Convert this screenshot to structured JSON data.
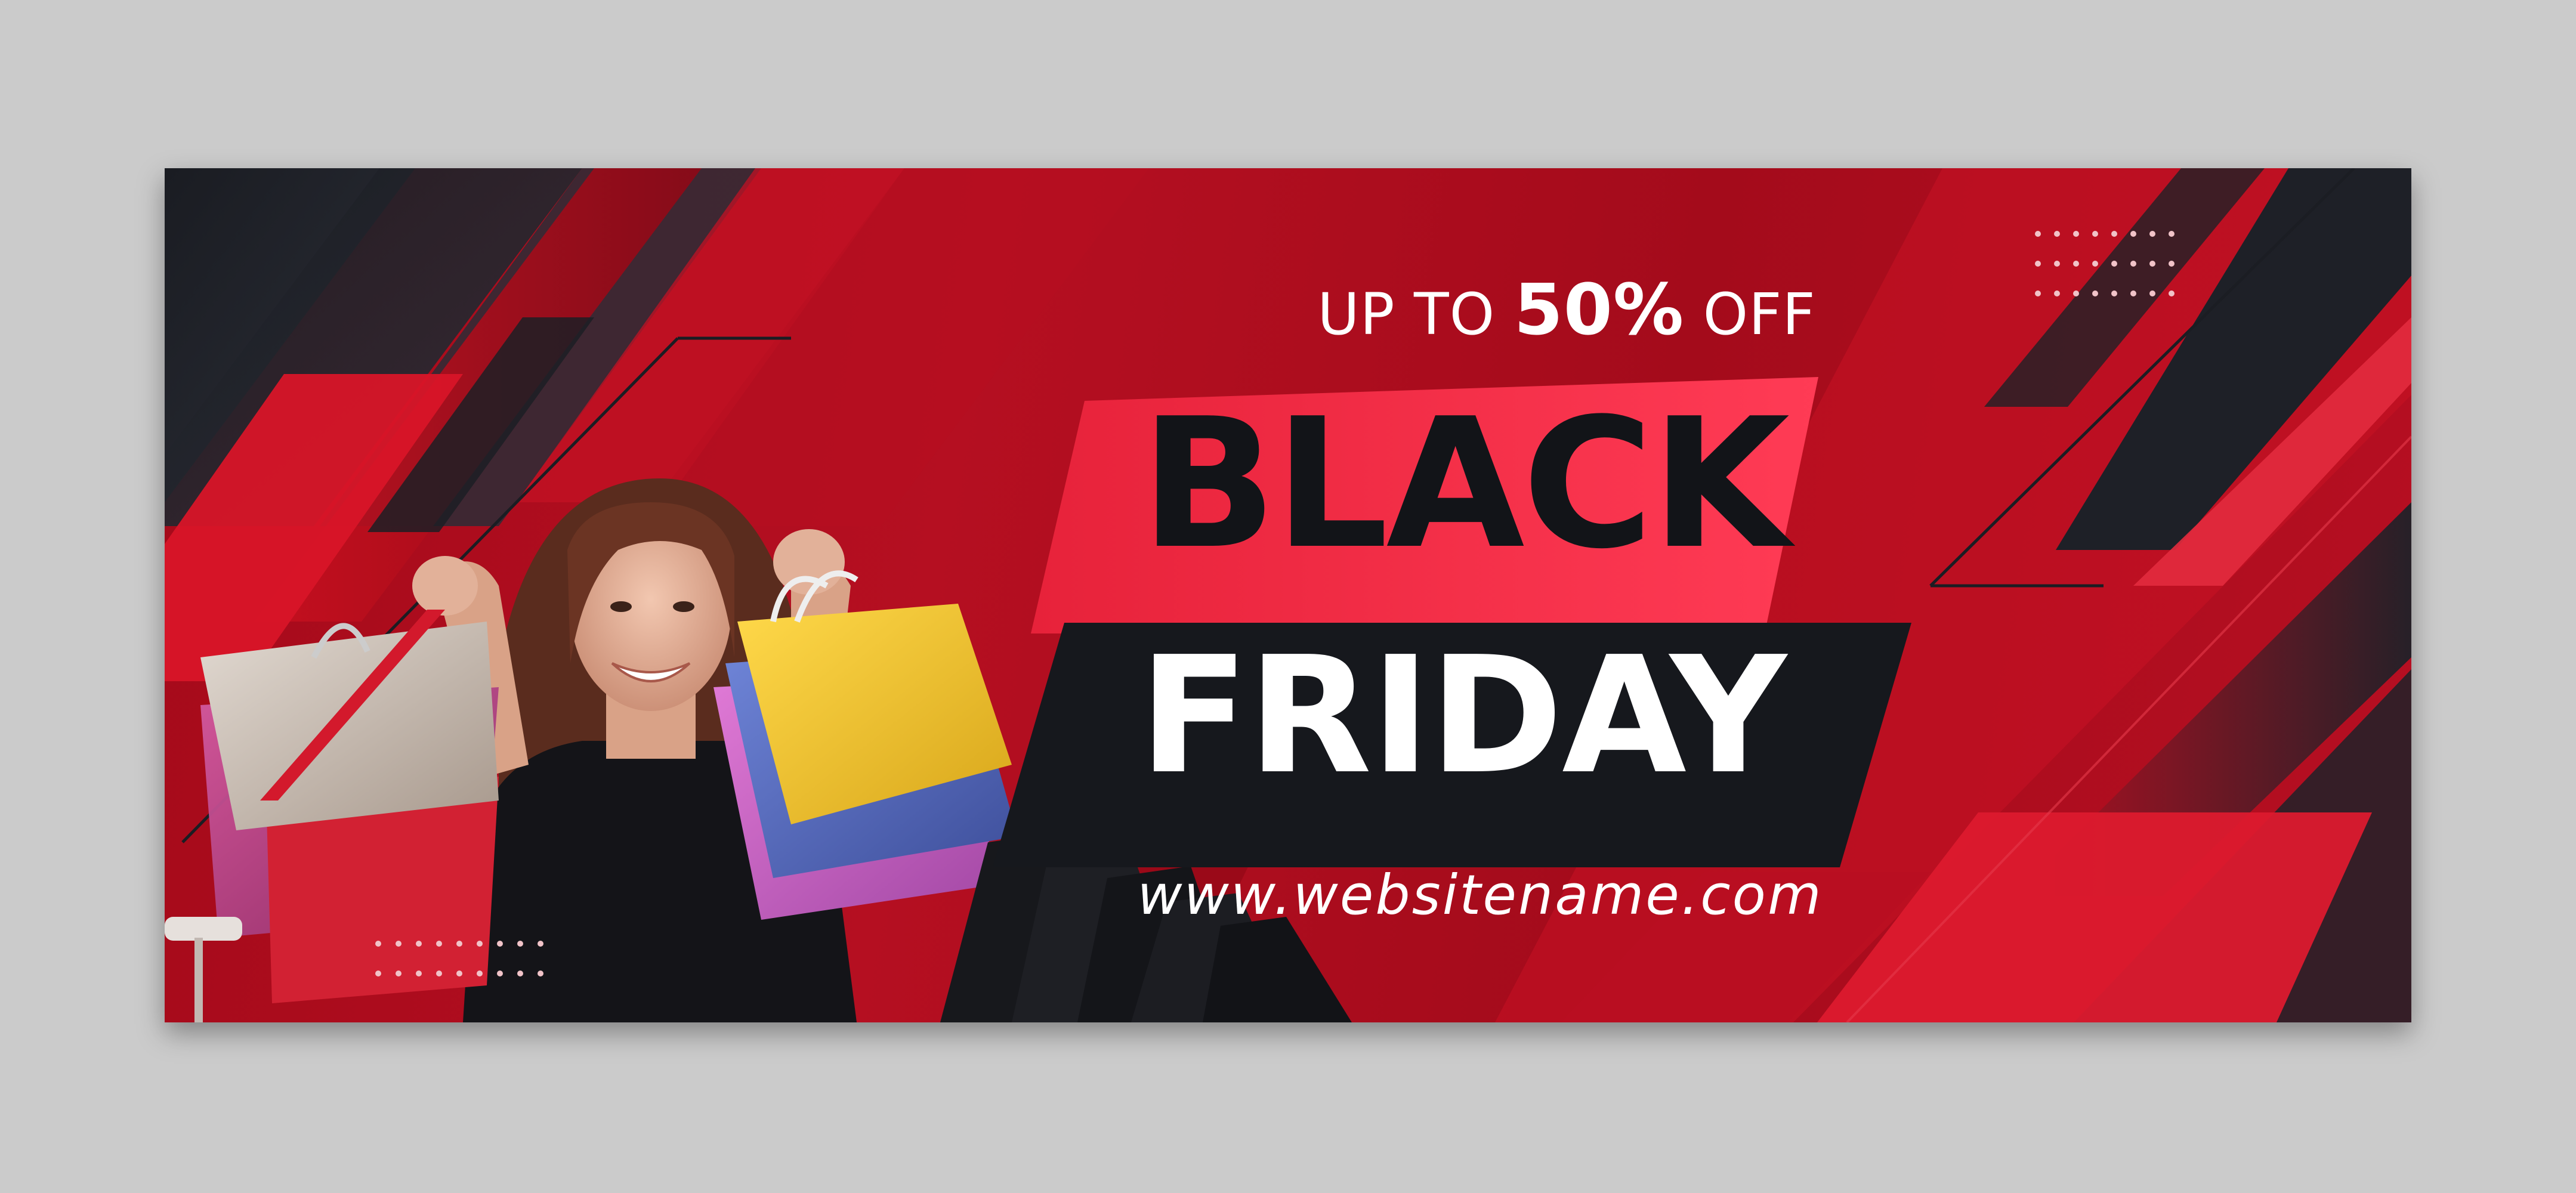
{
  "banner": {
    "offer_prefix": "UP TO",
    "offer_percent": "50%",
    "offer_suffix": "OFF",
    "title_line1": "BLACK",
    "title_line2": "FRIDAY",
    "website": "www.websitename.com"
  },
  "colors": {
    "page_bg": "#cbcbcb",
    "banner_red": "#b00e1f",
    "accent_red": "#e3253c",
    "dark": "#16181d",
    "white": "#ffffff"
  },
  "photo": {
    "subject": "smiling woman holding colorful shopping bags",
    "items": [
      "white-bag-icon",
      "pink-bag-icon",
      "yellow-bag-icon",
      "blue-bag-icon",
      "purple-bag-icon",
      "clothes-rack-icon"
    ]
  }
}
